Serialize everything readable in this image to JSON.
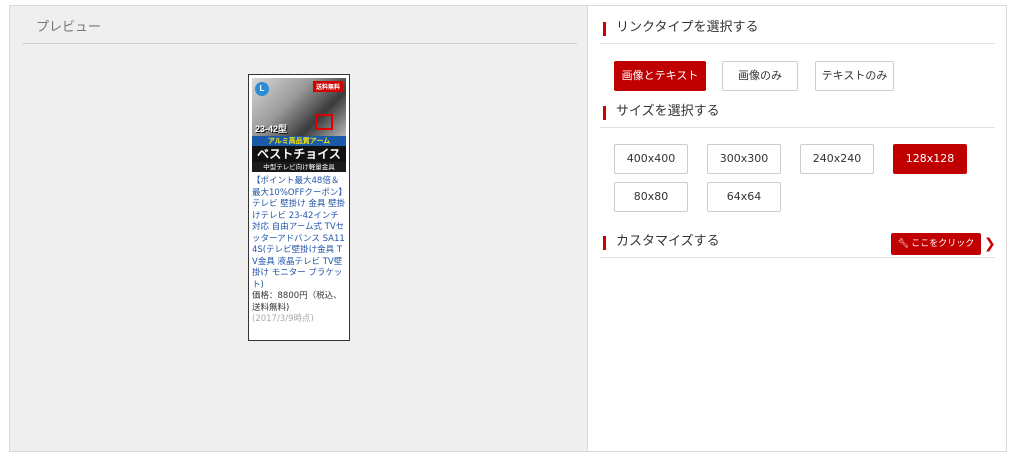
{
  "preview": {
    "title": "プレビュー",
    "ad": {
      "logo": "L",
      "free_shipping_badge": "送料無料",
      "size_label": "23-42型",
      "band_line1": "アルミ高品質アーム",
      "band_line2": "ベストチョイス",
      "band_line3": "中型テレビ向け軽量金具",
      "description": "【ポイント最大48倍＆最大10%OFFクーポン】テレビ 壁掛け 金具 壁掛けテレビ 23-42インチ対応 自由アーム式 TVセッターアドバンス SA114S(テレビ壁掛け金具 TV金具 液晶テレビ TV壁掛け モニター ブラケット)",
      "price": "価格：8800円（税込、送料無料)",
      "date": "(2017/3/9時点)"
    }
  },
  "link_type": {
    "heading": "リンクタイプを選択する",
    "options": [
      "画像とテキスト",
      "画像のみ",
      "テキストのみ"
    ],
    "selected": "画像とテキスト"
  },
  "size": {
    "heading": "サイズを選択する",
    "options": [
      "400x400",
      "300x300",
      "240x240",
      "128x128",
      "80x80",
      "64x64"
    ],
    "selected": "128x128"
  },
  "customize": {
    "heading": "カスタマイズする",
    "button_label": "ここをクリック",
    "button_icon": "wrench-icon",
    "chevron_icon": "chevron-right-icon"
  },
  "colors": {
    "accent": "#c00000",
    "preview_bg": "#efefef"
  }
}
